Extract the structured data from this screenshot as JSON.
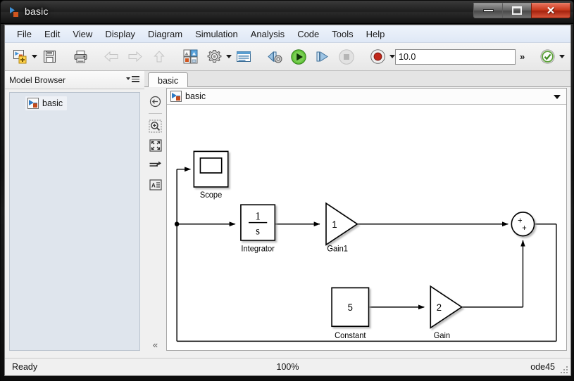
{
  "window": {
    "title": "basic",
    "icon": "simulink-model-icon",
    "buttons": {
      "minimize": "minimize-button",
      "maximize": "maximize-button",
      "close": "✕"
    }
  },
  "menubar": {
    "items": [
      {
        "label": "File",
        "name": "menu-file"
      },
      {
        "label": "Edit",
        "name": "menu-edit"
      },
      {
        "label": "View",
        "name": "menu-view"
      },
      {
        "label": "Display",
        "name": "menu-display"
      },
      {
        "label": "Diagram",
        "name": "menu-diagram"
      },
      {
        "label": "Simulation",
        "name": "menu-simulation"
      },
      {
        "label": "Analysis",
        "name": "menu-analysis"
      },
      {
        "label": "Code",
        "name": "menu-code"
      },
      {
        "label": "Tools",
        "name": "menu-tools"
      },
      {
        "label": "Help",
        "name": "menu-help"
      }
    ]
  },
  "toolbar": {
    "new_model": "new-model-icon",
    "save": "save-icon",
    "print": "print-icon",
    "back": "back-arrow-icon",
    "forward": "forward-arrow-icon",
    "up": "up-arrow-icon",
    "library_browser": "library-browser-icon",
    "model_configuration": "gear-icon",
    "model_explorer": "model-explorer-icon",
    "update_model": "build-model-icon",
    "run": "run-icon",
    "step_forward": "step-forward-icon",
    "stop": "stop-icon",
    "record": "record-icon",
    "stop_time_value": "10.0",
    "stop_time_placeholder": "10.0",
    "overflow": "»",
    "fast_restart": "fast-restart-icon",
    "simulation_data_inspector": "data-inspector-icon"
  },
  "browser": {
    "title": "Model Browser",
    "menu_icon": "browser-options-icon",
    "tree": [
      {
        "label": "basic",
        "icon": "simulink-model-icon"
      }
    ]
  },
  "editor": {
    "tabs": [
      {
        "label": "basic",
        "active": true
      }
    ],
    "breadcrumb": {
      "icon": "simulink-model-icon",
      "label": "basic"
    },
    "sidebar_tools": [
      {
        "name": "navigate-up-icon",
        "label": "Navigate up"
      },
      {
        "name": "zoom-region-icon",
        "label": "Zoom to region"
      },
      {
        "name": "fit-to-view-icon",
        "label": "Fit diagram to view"
      },
      {
        "name": "signal-port-icon",
        "label": "Port/signal"
      },
      {
        "name": "annotation-icon",
        "label": "Annotation"
      }
    ],
    "collapse": "«"
  },
  "statusbar": {
    "status": "Ready",
    "zoom": "100%",
    "solver": "ode45"
  },
  "diagram": {
    "blocks": [
      {
        "id": "scope",
        "type": "scope",
        "label": "Scope",
        "value": ""
      },
      {
        "id": "integrator",
        "type": "transfer",
        "label": "Integrator",
        "numerator": "1",
        "denominator": "s"
      },
      {
        "id": "gain1",
        "type": "gain",
        "label": "Gain1",
        "value": "1"
      },
      {
        "id": "constant",
        "type": "constant",
        "label": "Constant",
        "value": "5"
      },
      {
        "id": "gain",
        "type": "gain",
        "label": "Gain",
        "value": "2"
      },
      {
        "id": "sum",
        "type": "sum",
        "label": "",
        "signs": [
          "+",
          "+"
        ]
      }
    ],
    "signals": [
      {
        "from": "sum",
        "to": "feedback-junction"
      },
      {
        "from": "junction",
        "to": "scope"
      },
      {
        "from": "junction",
        "to": "integrator"
      },
      {
        "from": "integrator",
        "to": "gain1"
      },
      {
        "from": "gain1",
        "to": "sum"
      },
      {
        "from": "constant",
        "to": "gain"
      },
      {
        "from": "gain",
        "to": "sum"
      }
    ]
  }
}
